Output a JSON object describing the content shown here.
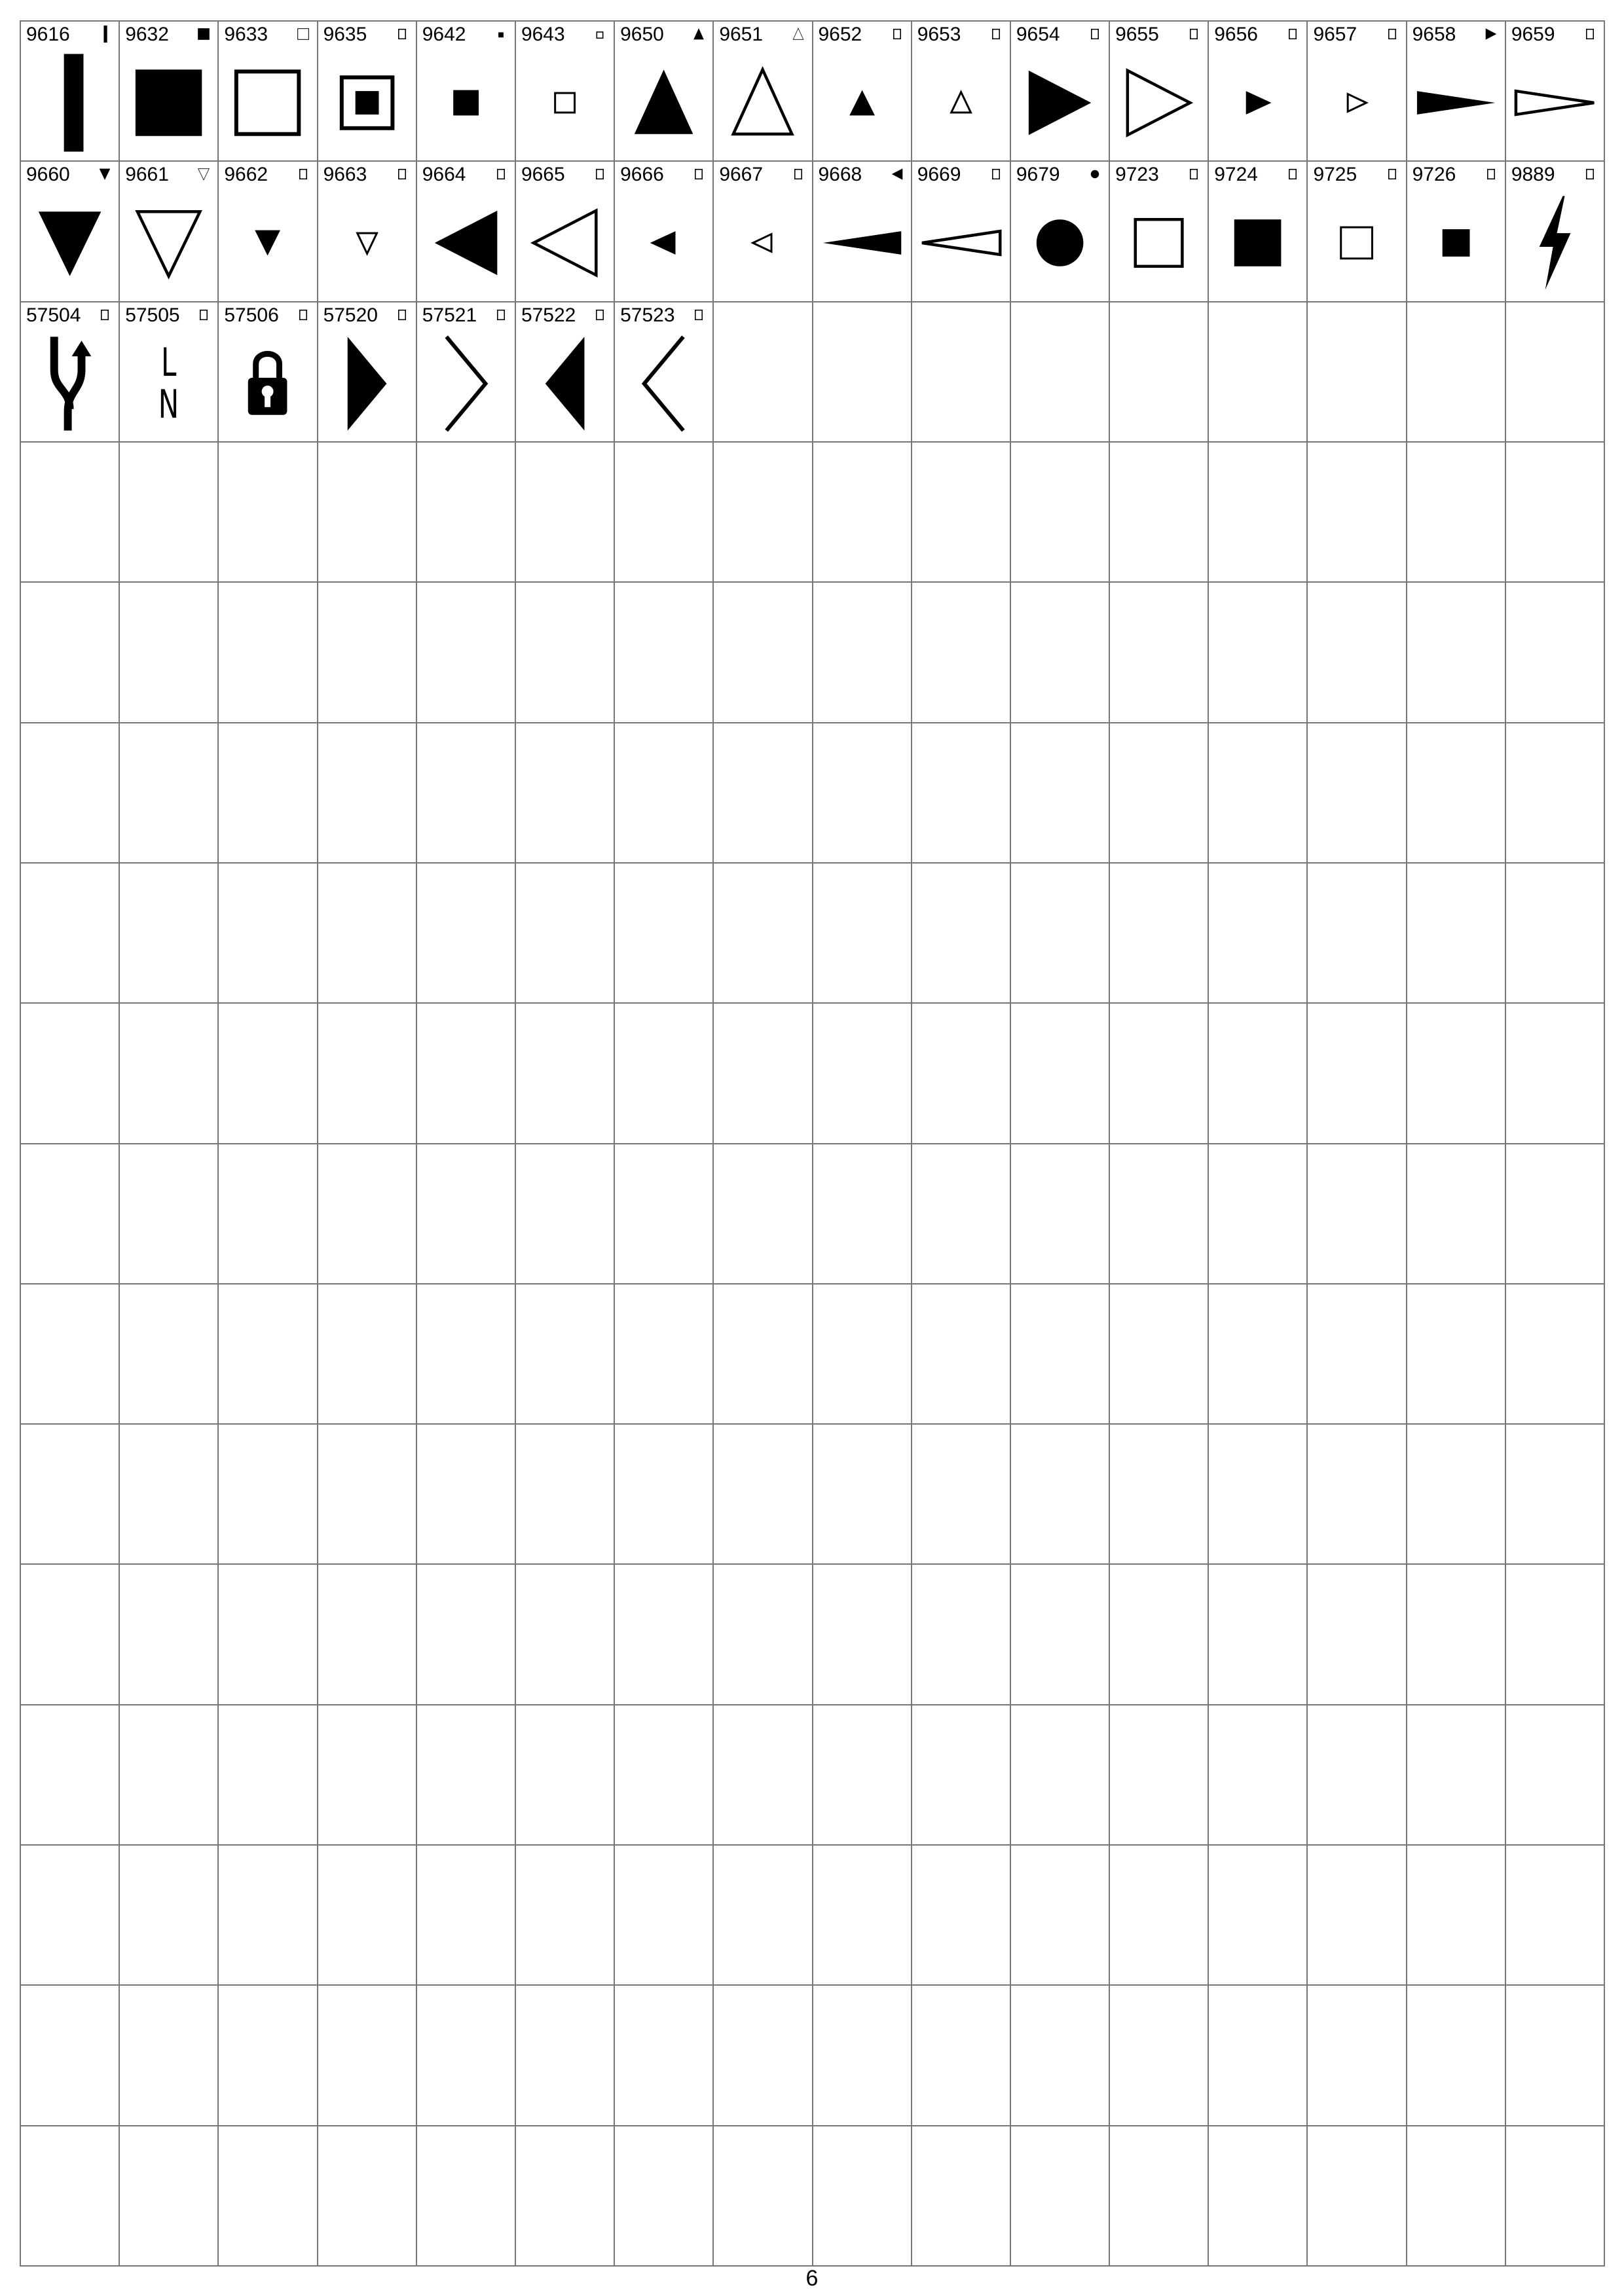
{
  "page": {
    "number": "6"
  },
  "table": {
    "columns": 16,
    "rows": 16,
    "cells": [
      {
        "code": "9616",
        "icon": "vertical-bar",
        "mini": "vertical-bar"
      },
      {
        "code": "9632",
        "icon": "filled-square",
        "mini": "filled-square"
      },
      {
        "code": "9633",
        "icon": "outline-square",
        "mini": "outline-square"
      },
      {
        "code": "9635",
        "icon": "square-in-square",
        "mini": "missing-glyph"
      },
      {
        "code": "9642",
        "icon": "small-filled-square",
        "mini": "tiny-filled-square"
      },
      {
        "code": "9643",
        "icon": "small-outline-square",
        "mini": "tiny-outline-square"
      },
      {
        "code": "9650",
        "icon": "filled-triangle-up",
        "mini": "filled-triangle-up"
      },
      {
        "code": "9651",
        "icon": "outline-triangle-up",
        "mini": "outline-triangle-up"
      },
      {
        "code": "9652",
        "icon": "small-filled-triangle-up",
        "mini": "missing-glyph"
      },
      {
        "code": "9653",
        "icon": "small-outline-triangle-up",
        "mini": "missing-glyph"
      },
      {
        "code": "9654",
        "icon": "filled-triangle-right",
        "mini": "missing-glyph"
      },
      {
        "code": "9655",
        "icon": "outline-triangle-right",
        "mini": "missing-glyph"
      },
      {
        "code": "9656",
        "icon": "small-filled-triangle-right",
        "mini": "missing-glyph"
      },
      {
        "code": "9657",
        "icon": "small-outline-triangle-right",
        "mini": "missing-glyph"
      },
      {
        "code": "9658",
        "icon": "filled-pointer-right",
        "mini": "filled-triangle-right"
      },
      {
        "code": "9659",
        "icon": "outline-pointer-right",
        "mini": "missing-glyph"
      },
      {
        "code": "9660",
        "icon": "filled-triangle-down",
        "mini": "filled-triangle-down"
      },
      {
        "code": "9661",
        "icon": "outline-triangle-down",
        "mini": "outline-triangle-down"
      },
      {
        "code": "9662",
        "icon": "small-filled-triangle-down",
        "mini": "missing-glyph"
      },
      {
        "code": "9663",
        "icon": "small-outline-triangle-down",
        "mini": "missing-glyph"
      },
      {
        "code": "9664",
        "icon": "filled-triangle-left",
        "mini": "missing-glyph"
      },
      {
        "code": "9665",
        "icon": "outline-triangle-left",
        "mini": "missing-glyph"
      },
      {
        "code": "9666",
        "icon": "small-filled-triangle-left",
        "mini": "missing-glyph"
      },
      {
        "code": "9667",
        "icon": "small-outline-triangle-left",
        "mini": "missing-glyph"
      },
      {
        "code": "9668",
        "icon": "filled-pointer-left",
        "mini": "filled-triangle-left"
      },
      {
        "code": "9669",
        "icon": "outline-pointer-left",
        "mini": "missing-glyph"
      },
      {
        "code": "9679",
        "icon": "filled-circle",
        "mini": "filled-circle"
      },
      {
        "code": "9723",
        "icon": "medium-outline-square",
        "mini": "missing-glyph"
      },
      {
        "code": "9724",
        "icon": "medium-filled-square",
        "mini": "missing-glyph"
      },
      {
        "code": "9725",
        "icon": "medium-small-outline-square",
        "mini": "missing-glyph"
      },
      {
        "code": "9726",
        "icon": "medium-small-filled-square",
        "mini": "missing-glyph"
      },
      {
        "code": "9889",
        "icon": "lightning-bolt",
        "mini": "missing-glyph"
      },
      {
        "code": "57504",
        "icon": "lane-merge-arrow",
        "mini": "missing-glyph"
      },
      {
        "code": "57505",
        "icon": "letters-l-n",
        "mini": "missing-glyph",
        "glyph_text": [
          "L",
          "N"
        ]
      },
      {
        "code": "57506",
        "icon": "padlock",
        "mini": "missing-glyph"
      },
      {
        "code": "57520",
        "icon": "filled-half-diamond-right",
        "mini": "missing-glyph"
      },
      {
        "code": "57521",
        "icon": "chevron-right",
        "mini": "missing-glyph"
      },
      {
        "code": "57522",
        "icon": "filled-half-diamond-left",
        "mini": "missing-glyph"
      },
      {
        "code": "57523",
        "icon": "chevron-left",
        "mini": "missing-glyph"
      }
    ]
  }
}
